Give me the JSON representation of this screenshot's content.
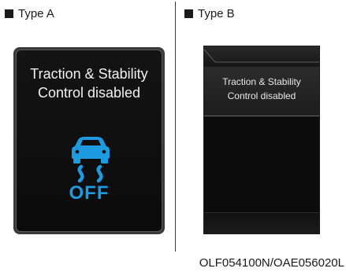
{
  "type_a": {
    "label": "Type A",
    "message_line1": "Traction & Stability",
    "message_line2": "Control disabled",
    "indicator": {
      "icon": "traction-control-off-icon",
      "status_text": "OFF",
      "color": "#1e9ae0"
    }
  },
  "type_b": {
    "label": "Type B",
    "message_line1": "Traction & Stability",
    "message_line2": "Control disabled"
  },
  "reference_code": "OLF054100N/OAE056020L"
}
